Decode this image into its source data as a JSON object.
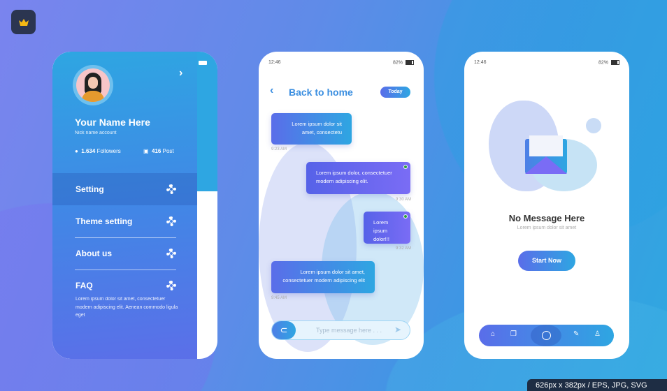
{
  "watermark": {
    "dimensions": "626px x 382px / EPS, JPG, SVG"
  },
  "profile": {
    "name": "Your Name Here",
    "nickname": "Nick name account",
    "followers_count": "1.634",
    "followers_label": "Followers",
    "posts_count": "416",
    "posts_label": "Post",
    "menu": [
      {
        "label": "Setting"
      },
      {
        "label": "Theme setting"
      },
      {
        "label": "About us"
      },
      {
        "label": "FAQ"
      }
    ],
    "faq_text": "Lorem ipsum dolor sit amet, consectetuer modern  adipiscing elit. Aenean commodo ligula eget"
  },
  "chat": {
    "time": "12:46",
    "battery": "82%",
    "title": "Back to home",
    "badge": "Today",
    "messages": [
      {
        "text": "Lorem ipsum dolor sit amet, consectetu",
        "time": "9:23 AM"
      },
      {
        "text": "Lorem ipsum dolor, consectetuer modern  adipiscing elit.",
        "time": "9:30 AM"
      },
      {
        "text": "Lorem ipsum dolor!!!",
        "time": "9:32 AM"
      },
      {
        "text": "Lorem ipsum dolor sit amet, consectetuer modern  adipiscing elit",
        "time": "9:45 AM"
      }
    ],
    "input_placeholder": "Type message here . . ."
  },
  "empty": {
    "time": "12:46",
    "battery": "82%",
    "title": "No Message Here",
    "subtitle": "Lorem ipsum dolor sit amet",
    "button": "Start Now"
  }
}
